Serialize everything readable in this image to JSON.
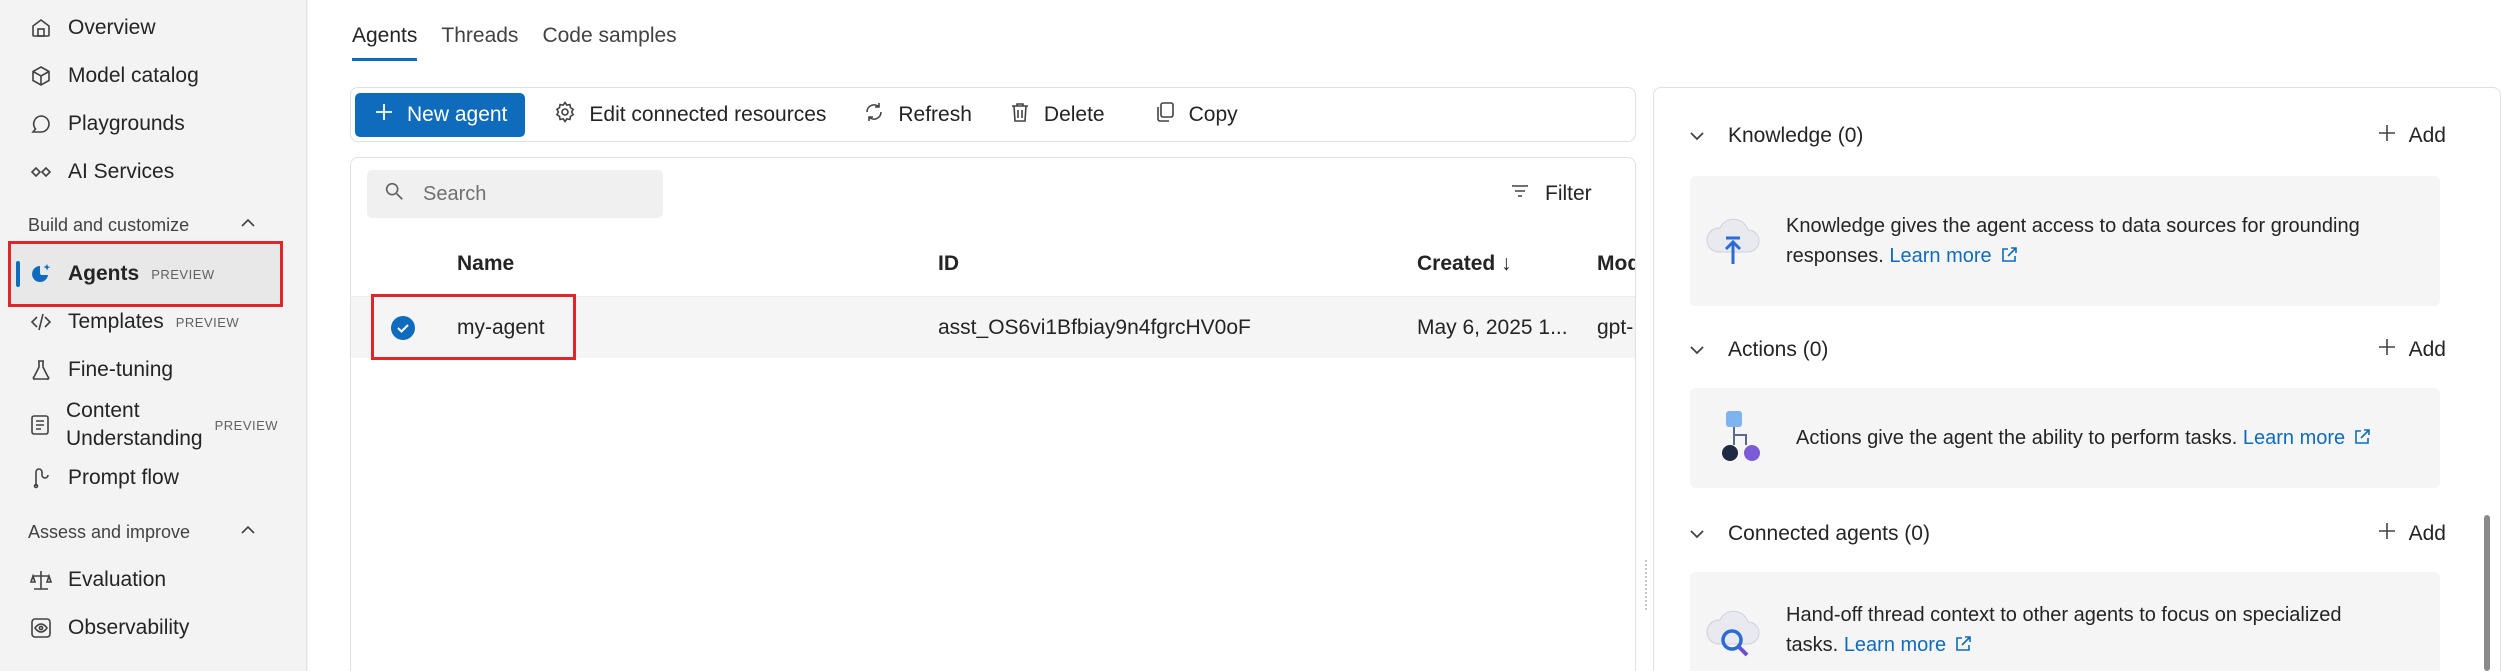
{
  "sidebar": {
    "items": [
      {
        "label": "Overview",
        "icon": "home-icon"
      },
      {
        "label": "Model catalog",
        "icon": "cube-icon"
      },
      {
        "label": "Playgrounds",
        "icon": "chat-icon"
      },
      {
        "label": "AI Services",
        "icon": "link-icon"
      }
    ],
    "section1": {
      "label": "Build and customize"
    },
    "build_items": [
      {
        "label": "Agents",
        "badge": "PREVIEW",
        "icon": "agents-icon"
      },
      {
        "label": "Templates",
        "badge": "PREVIEW",
        "icon": "code-icon"
      },
      {
        "label": "Fine-tuning",
        "icon": "flask-icon"
      },
      {
        "label_line1": "Content",
        "label_line2": "Understanding",
        "badge": "PREVIEW",
        "icon": "document-icon"
      },
      {
        "label": "Prompt flow",
        "icon": "flow-icon"
      }
    ],
    "section2": {
      "label": "Assess and improve"
    },
    "assess_items": [
      {
        "label": "Evaluation",
        "icon": "scale-icon"
      },
      {
        "label": "Observability",
        "icon": "eye-icon"
      }
    ]
  },
  "tabs": [
    {
      "label": "Agents",
      "active": true
    },
    {
      "label": "Threads"
    },
    {
      "label": "Code samples"
    }
  ],
  "toolbar": {
    "new_agent": "New agent",
    "edit": "Edit connected resources",
    "refresh": "Refresh",
    "delete": "Delete",
    "copy": "Copy"
  },
  "list": {
    "search_placeholder": "Search",
    "filter": "Filter",
    "columns": [
      "Name",
      "ID",
      "Created ↓",
      "Mod"
    ],
    "rows": [
      {
        "name": "my-agent",
        "id": "asst_OS6vi1Bfbiay9n4fgrcHV0oF",
        "created": "May 6, 2025 1...",
        "model": "gpt-"
      }
    ]
  },
  "details": {
    "add_label": "Add",
    "knowledge": {
      "title": "Knowledge (0)",
      "text1": "Knowledge gives the agent access to data sources for grounding",
      "text2": "responses.",
      "learn": "Learn more"
    },
    "actions": {
      "title": "Actions (0)",
      "text": "Actions give the agent the ability to perform tasks.",
      "learn": "Learn more"
    },
    "connected": {
      "title": "Connected agents (0)",
      "text1": "Hand-off thread context to other agents to focus on specialized",
      "text2": "tasks.",
      "learn": "Learn more"
    }
  },
  "colors": {
    "accent": "#0f6cbd",
    "highlight": "#e0262b"
  }
}
